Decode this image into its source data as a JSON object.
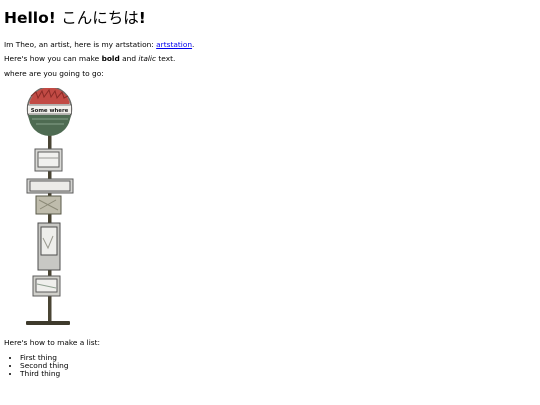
{
  "heading": {
    "hello": "Hello!",
    "japanese": "こんにちは",
    "bang": "!"
  },
  "intro": {
    "before": "Im Theo, an artist, here is my artstation: ",
    "link_text": "artstation",
    "after": "."
  },
  "formatting": {
    "before": "Here's how you can make ",
    "bold": "bold",
    "middle": " and ",
    "italic": "italic",
    "after": " text."
  },
  "question": "where are you going to go:",
  "sign_text": "Some where",
  "list_intro": "Here's how to make a list:",
  "list_items": [
    "First thing",
    "Second thing",
    "Third thing"
  ],
  "colors": {
    "link": "#0000ee",
    "sign_red": "#c24a44",
    "sign_green": "#4e6b52",
    "pole": "#4a4534"
  }
}
